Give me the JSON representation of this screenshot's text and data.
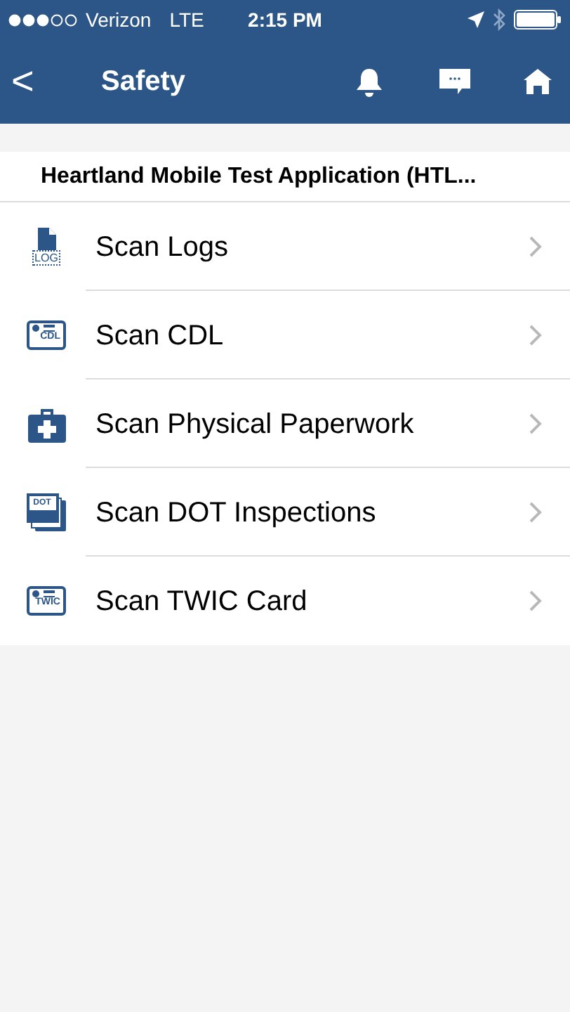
{
  "status_bar": {
    "carrier": "Verizon",
    "network": "LTE",
    "time": "2:15 PM"
  },
  "nav_bar": {
    "back": "<",
    "title": "Safety"
  },
  "section": {
    "title": "Heartland Mobile Test Application (HTL..."
  },
  "items": [
    {
      "label": "Scan Logs",
      "kind": "document",
      "icon_label": "LOG"
    },
    {
      "label": "Scan CDL",
      "kind": "card",
      "icon_label": "CDL"
    },
    {
      "label": "Scan Physical Paperwork",
      "kind": "medkit"
    },
    {
      "label": "Scan DOT Inspections",
      "kind": "stack",
      "icon_label": "DOT"
    },
    {
      "label": "Scan TWIC Card",
      "kind": "card",
      "icon_label": "TWIC"
    }
  ]
}
